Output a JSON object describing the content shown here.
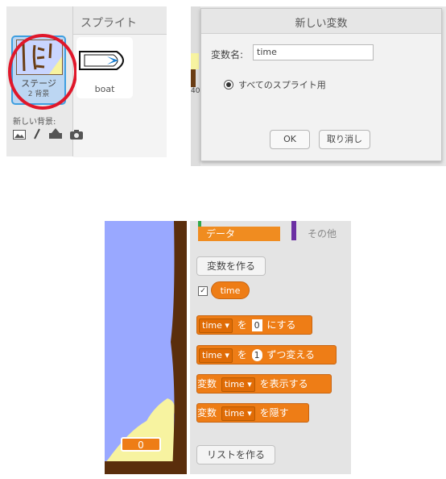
{
  "panel_sprites": {
    "title": "スプライト",
    "stage": {
      "name": "ステージ",
      "backdrop_count": "2 背景"
    },
    "new_backdrop_label": "新しい背景:",
    "sprites": [
      {
        "name": "boat"
      }
    ],
    "icons": [
      "image-icon",
      "paint-icon",
      "upload-icon",
      "camera-icon"
    ],
    "highlight_color": "#e0172a"
  },
  "dialog": {
    "title": "新しい変数",
    "name_label": "変数名:",
    "name_value": "time",
    "scope_option": "すべてのスプライト用",
    "ok": "OK",
    "cancel": "取り消し",
    "left_fragment": "40"
  },
  "palette": {
    "tabs": {
      "data": "データ",
      "other": "その他"
    },
    "make_variable": "変数を作る",
    "variable_reporter": "time",
    "variable_checked": true,
    "blocks": {
      "set": {
        "var": "time",
        "text_a": "を",
        "value": "0",
        "text_b": "にする"
      },
      "change": {
        "var": "time",
        "text_a": "を",
        "value": "1",
        "text_b": "ずつ変える"
      },
      "show": {
        "text_a": "変数",
        "var": "time",
        "text_b": "を表示する"
      },
      "hide": {
        "text_a": "変数",
        "var": "time",
        "text_b": "を隠す"
      }
    },
    "make_list": "リストを作る",
    "block_color": "#ee7d16"
  },
  "stage_monitor": {
    "value": "0"
  }
}
